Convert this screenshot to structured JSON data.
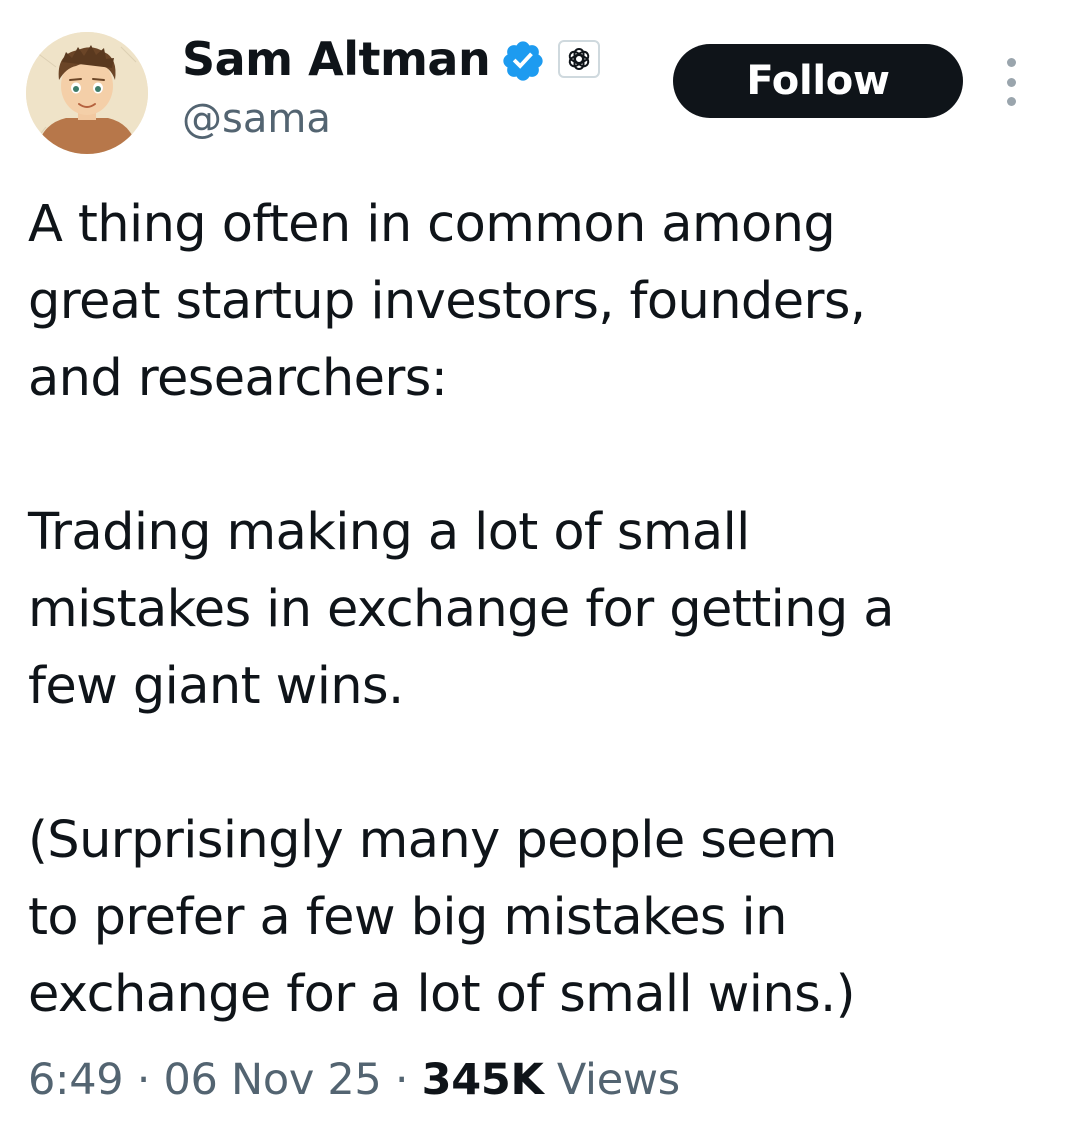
{
  "author": {
    "display_name": "Sam Altman",
    "handle": "@sama",
    "verified": true,
    "verified_color": "#1d9bf0",
    "affiliate_icon": "openai-logo-icon"
  },
  "actions": {
    "follow_label": "Follow",
    "more_icon": "more-vertical-icon"
  },
  "tweet": {
    "paragraphs": [
      {
        "lines": [
          "A thing often in common among",
          "great startup investors, founders,",
          "and researchers:"
        ]
      },
      {
        "lines": [
          "Trading making a lot of small",
          "mistakes in exchange for getting a",
          "few giant wins."
        ]
      },
      {
        "lines": [
          "(Surprisingly many people seem",
          "to prefer a few big mistakes in",
          "exchange for a lot of small wins.)"
        ]
      }
    ]
  },
  "meta": {
    "time": "6:49",
    "separator": "·",
    "date": "06 Nov 25",
    "views_count": "345K",
    "views_label": "Views"
  },
  "colors": {
    "text": "#0f1419",
    "secondary_text": "#536471",
    "button_bg": "#0f1419",
    "button_text": "#ffffff"
  }
}
